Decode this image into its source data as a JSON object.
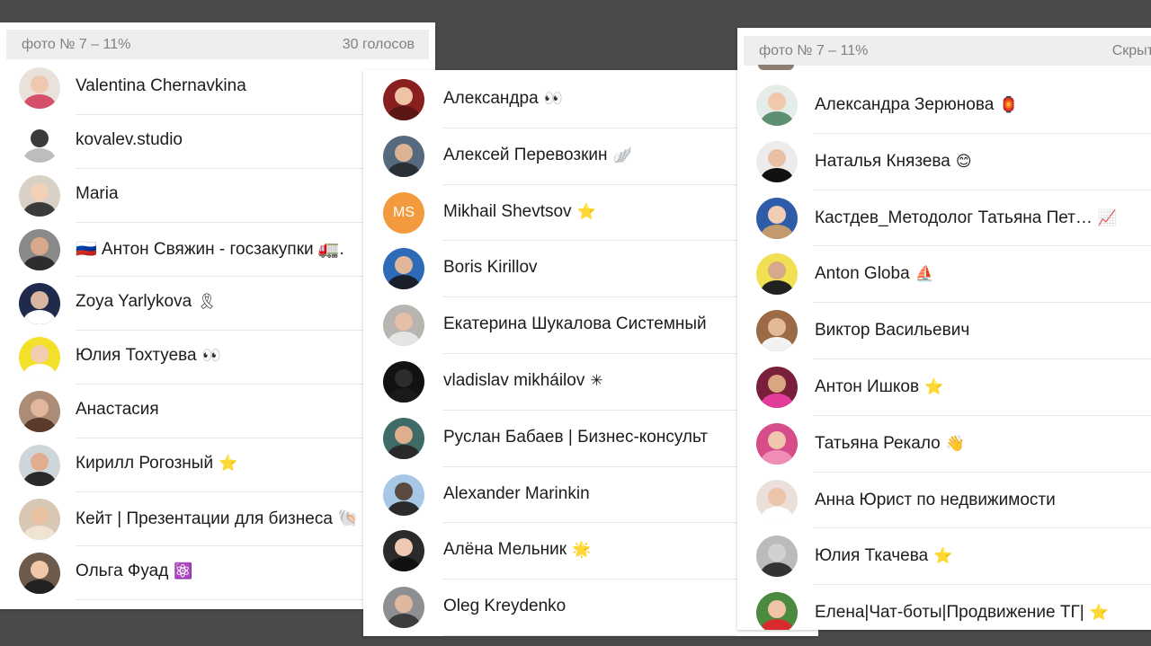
{
  "panels": [
    {
      "header": {
        "left": "фото № 7 – 11%",
        "right": "30 голосов"
      },
      "voters": [
        {
          "name": "Valentina Chernavkina",
          "badge": "",
          "avatar": {
            "bg": "#e9e2da",
            "face": "#f0c7b0",
            "body": "#d54f6a"
          }
        },
        {
          "name": "kovalev.studio",
          "badge": "",
          "avatar": {
            "bg": "#ffffff",
            "face": "#3a3a3a",
            "body": "#bdbdbd"
          }
        },
        {
          "name": "Maria",
          "badge": "",
          "avatar": {
            "bg": "#d9d1c6",
            "face": "#f1d1b7",
            "body": "#3b3b3b"
          }
        },
        {
          "name": "🇷🇺 Антон Свяжин - госзакупки 🚛.",
          "badge": "",
          "avatar": {
            "bg": "#8a8a8a",
            "face": "#d9a98c",
            "body": "#2d2d2d"
          }
        },
        {
          "name": "Zoya Yarlykova",
          "badge": "🎗",
          "avatar": {
            "bg": "#1f2a4d",
            "face": "#d8b6a0",
            "body": "#ffffff"
          }
        },
        {
          "name": "Юлия Тохтуева",
          "badge": "👀",
          "avatar": {
            "bg": "#f2e02b",
            "face": "#f3cdb1",
            "body": "#ffffff"
          }
        },
        {
          "name": "Анастасия",
          "badge": "",
          "avatar": {
            "bg": "#ad8c77",
            "face": "#e2b79c",
            "body": "#5a3b2c"
          }
        },
        {
          "name": "Кирилл Рогозный",
          "badge": "⭐",
          "avatar": {
            "bg": "#cfd6d9",
            "face": "#e0ad8e",
            "body": "#2a2a2a"
          }
        },
        {
          "name": "Кейт | Презентации для бизнеса 🐚",
          "badge": "",
          "avatar": {
            "bg": "#d8c7b2",
            "face": "#e8c1a3",
            "body": "#efe4d3"
          }
        },
        {
          "name": "Ольга Фуад",
          "badge": "⚛️",
          "avatar": {
            "bg": "#6d5a4c",
            "face": "#f0c7a8",
            "body": "#222222"
          }
        }
      ]
    },
    {
      "header": {
        "left": "",
        "right": ""
      },
      "voters": [
        {
          "name": "Александра",
          "badge": "👀",
          "avatar": {
            "bg": "#8a1f1f",
            "face": "#efc3a6",
            "body": "#5b1616"
          }
        },
        {
          "name": "Алексей Перевозкин",
          "badge": "🪽",
          "avatar": {
            "bg": "#566a7f",
            "face": "#ddb394",
            "body": "#2a2f36"
          }
        },
        {
          "name": "Mikhail Shevtsov",
          "badge": "⭐",
          "avatar": {
            "bg": "#f39a3e",
            "initials": "MS"
          }
        },
        {
          "name": "Boris Kirillov",
          "badge": "",
          "avatar": {
            "bg": "#2d6ab8",
            "face": "#e0b79b",
            "body": "#1b1f2b"
          }
        },
        {
          "name": "Екатерина Шукалова Системный",
          "badge": "",
          "avatar": {
            "bg": "#b8b4b0",
            "face": "#e6c0a6",
            "body": "#e5e5e5"
          }
        },
        {
          "name": "vladislav mikháilov",
          "badge": "✳",
          "avatar": {
            "bg": "#111111",
            "face": "#2c2c2c",
            "body": "#1a1a1a"
          }
        },
        {
          "name": "Руслан Бабаев | Бизнес-консульт",
          "badge": "",
          "avatar": {
            "bg": "#3f6b66",
            "face": "#deae8f",
            "body": "#2a2a2a"
          }
        },
        {
          "name": "Alexander Marinkin",
          "badge": "",
          "avatar": {
            "bg": "#a6c8e6",
            "face": "#5a4a40",
            "body": "#2b2b2b"
          }
        },
        {
          "name": "Алёна Мельник",
          "badge": "🌟",
          "avatar": {
            "bg": "#2b2b2b",
            "face": "#efc9b2",
            "body": "#111111"
          }
        },
        {
          "name": "Oleg Kreydenko",
          "badge": "",
          "avatar": {
            "bg": "#8d8f93",
            "face": "#e0b89e",
            "body": "#3c3c3c"
          }
        }
      ]
    },
    {
      "header": {
        "left": "фото № 7 – 11%",
        "right": "Скрыт"
      },
      "voters": [
        {
          "name": "Александра Зерюнова",
          "badge": "🏮",
          "avatar": {
            "bg": "#e6ece8",
            "face": "#f0c8ae",
            "body": "#5e8f73"
          }
        },
        {
          "name": "Наталья Князева",
          "badge": "😊",
          "avatar": {
            "bg": "#ececec",
            "face": "#e8c0a3",
            "body": "#111111"
          }
        },
        {
          "name": "Кастдев_Методолог Татьяна Пет…",
          "badge": "📈",
          "avatar": {
            "bg": "#2f5ca8",
            "face": "#f1cdb3",
            "body": "#c49a6c"
          }
        },
        {
          "name": "Anton Globa",
          "badge": "⛵",
          "avatar": {
            "bg": "#f1e052",
            "face": "#d7a98a",
            "body": "#222222"
          }
        },
        {
          "name": "Виктор Васильевич",
          "badge": "",
          "avatar": {
            "bg": "#9c6b46",
            "face": "#e4b995",
            "body": "#f2f2f2"
          }
        },
        {
          "name": "Антон Ишков",
          "badge": "⭐",
          "avatar": {
            "bg": "#7a1f3a",
            "face": "#d9a582",
            "body": "#e43c9a"
          }
        },
        {
          "name": "Татьяна Рекало",
          "badge": "👋",
          "avatar": {
            "bg": "#d64d8a",
            "face": "#f0c6ad",
            "body": "#ef8fb6"
          }
        },
        {
          "name": "Анна Юрист по недвижимости",
          "badge": "",
          "avatar": {
            "bg": "#eadfd9",
            "face": "#ecc4a9",
            "body": "#ffffff"
          }
        },
        {
          "name": "Юлия Ткачева",
          "badge": "⭐",
          "avatar": {
            "bg": "#bbbbbb",
            "face": "#d1d1d1",
            "body": "#333333"
          }
        },
        {
          "name": "Елена|Чат-боты|Продвижение ТГ|",
          "badge": "⭐",
          "avatar": {
            "bg": "#4b8a3f",
            "face": "#f0c5a7",
            "body": "#d92b2b"
          }
        }
      ]
    }
  ]
}
